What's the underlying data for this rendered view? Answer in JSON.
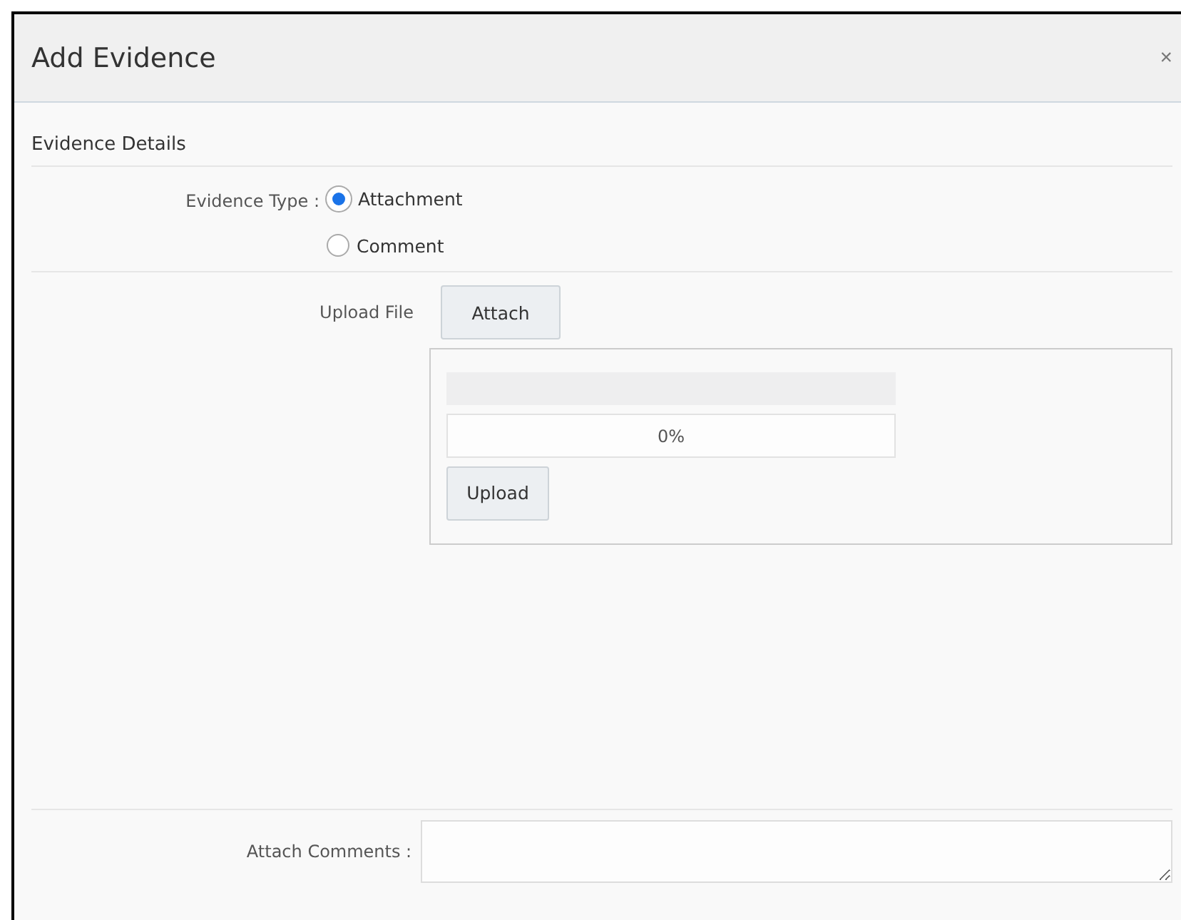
{
  "window": {
    "title": "Add Evidence",
    "close": "×"
  },
  "section": {
    "title": "Evidence Details"
  },
  "evidence_type": {
    "label": "Evidence Type :",
    "options": [
      {
        "label": "Attachment",
        "selected": true
      },
      {
        "label": "Comment",
        "selected": false
      }
    ]
  },
  "upload_file": {
    "label": "Upload File",
    "attach_button": "Attach",
    "progress": {
      "level": 0,
      "reading": "0%"
    },
    "upload_button": "Upload"
  },
  "attach_comments": {
    "label": "Attach Comments :"
  }
}
